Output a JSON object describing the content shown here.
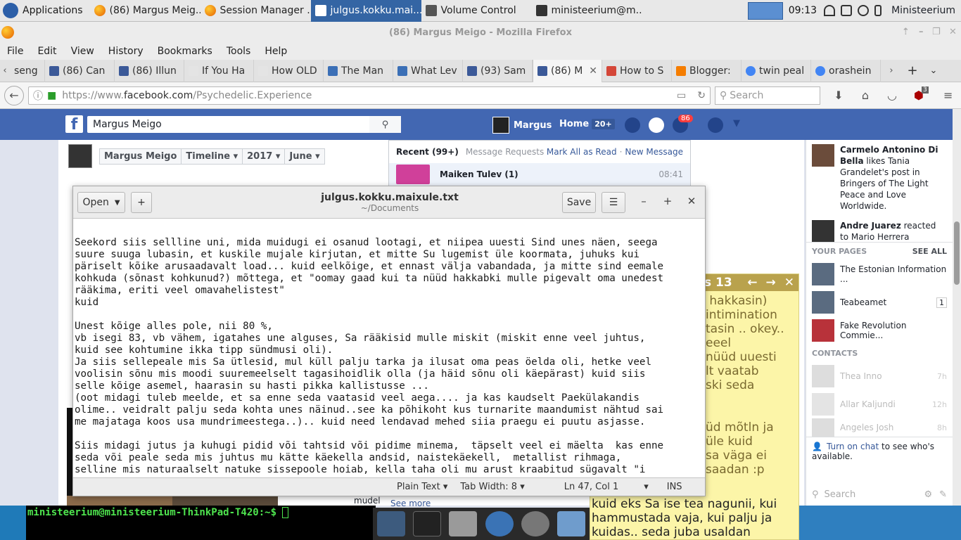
{
  "panel": {
    "apps_label": "Applications",
    "tasks": [
      {
        "label": "(86) Margus Meig...",
        "active": false
      },
      {
        "label": "Session Manager ...",
        "active": false
      },
      {
        "label": "julgus.kokku.mai...",
        "active": true
      },
      {
        "label": "Volume Control",
        "active": false
      },
      {
        "label": "ministeerium@m...",
        "active": false
      }
    ],
    "clock": "09:13",
    "user": "Ministeerium"
  },
  "firefox": {
    "title": "(86) Margus Meigo - Mozilla Firefox",
    "menu": [
      "File",
      "Edit",
      "View",
      "History",
      "Bookmarks",
      "Tools",
      "Help"
    ],
    "tabs": [
      {
        "label": "seng",
        "color": "#ffffff"
      },
      {
        "label": "(86) Can",
        "color": "#3b5998"
      },
      {
        "label": "(86) Illun",
        "color": "#3b5998"
      },
      {
        "label": "If You Ha",
        "color": "#e4e4e4"
      },
      {
        "label": "How OLD",
        "color": "#e4e4e4"
      },
      {
        "label": "The Man",
        "color": "#3b6fb6"
      },
      {
        "label": "What Lev",
        "color": "#3b6fb6"
      },
      {
        "label": "(93) Sam",
        "color": "#3b5998"
      },
      {
        "label": "(86) M",
        "color": "#3b5998",
        "active": true
      },
      {
        "label": "How to S",
        "color": "#d44638"
      },
      {
        "label": "Blogger:",
        "color": "#f57d00"
      },
      {
        "label": "twin peal",
        "color": "#4285f4"
      },
      {
        "label": "orashein",
        "color": "#4285f4"
      }
    ],
    "url_prefix": "https://www.",
    "url_host": "facebook.com",
    "url_path": "/Psychedelic.Experience",
    "search_placeholder": "Search",
    "ublock_count": "3"
  },
  "facebook": {
    "search_value": "Margus Meigo",
    "user_name": "Margus",
    "home_label": "Home",
    "home_count": "20+",
    "notif_count": "86",
    "timeline": {
      "name": "Margus Meigo",
      "tl": "Timeline",
      "year": "2017",
      "month": "June"
    },
    "messages": {
      "recent": "Recent (99+)",
      "requests": "Message Requests",
      "mark_all": "Mark All as Read",
      "new_message": "New Message",
      "first_sender": "Maiken Tulev (1)",
      "first_time": "08:41"
    },
    "ticker": [
      {
        "name": "Carmelo Antonino Di Bella",
        "text": " likes Tania Grandelet's post in Bringers of The Light Peace and Love Worldwide."
      },
      {
        "name": "Andre Juarez",
        "text": " reacted to Mario Herrera Azmitia's"
      }
    ],
    "your_pages_title": "YOUR PAGES",
    "see_all": "SEE ALL",
    "pages": [
      {
        "name": "The Estonian Information ...",
        "badge": ""
      },
      {
        "name": "Teabeamet",
        "badge": "1"
      },
      {
        "name": "Fake Revolution Commie...",
        "badge": ""
      }
    ],
    "contacts_title": "CONTACTS",
    "contacts": [
      {
        "name": "Thea Inno",
        "time": "7h"
      },
      {
        "name": "Allar Kaljundi",
        "time": "12h"
      },
      {
        "name": "Angeles Josh",
        "time": "8h"
      }
    ],
    "chat_link": "Turn on chat",
    "chat_note": " to see who's available.",
    "chat_search": "Search",
    "post_footer": "mudel",
    "see_more": "See more"
  },
  "sticky": {
    "header_num": "s 13",
    "lines": " hakkasin)\nintimination\ntasin .. okey..\neeel\nnüüd uuesti\nlt vaatab\nski seda\n\n\nüd mõtln ja\nüle kuid\nsa väga ei\nsaadan :p",
    "bottom_text": "kuid eks Sa ise tea nagunii, kui\nhammustada vaja, kui palju ja\nkuidas.. seda juba usaldan"
  },
  "gedit": {
    "open_label": "Open",
    "save_label": "Save",
    "filename": "julgus.kokku.maixule.txt",
    "path": "~/Documents",
    "text": "Seekord siis sellline uni, mida muidugi ei osanud lootagi, et niipea uuesti Sind unes näen, seega\nsuure suuga lubasin, et kuskile mujale kirjutan, et mitte Su lugemist üle koormata, juhuks kui\npäriselt kõike arusaadavalt load... kuid eelkõige, et ennast välja vabandada, ja mitte sind eemale\nkohkuda (sõnast kohkunud?) mõttega, et \"oomay gaad kui ta nüüd hakkabki mulle pigevalt oma unedest\nrääkima, eriti veel omavahelistest\"\nkuid\n\nUnest kõige alles pole, nii 80 %,\nvb isegi 83, vb vähem, igatahes une alguses, Sa rääkisid mulle miskit (miskit enne veel juhtus,\nkuid see kohtumine ikka tipp sündmusi oli).\nJa siis sellepeale mis Sa ütlesid, mul küll palju tarka ja ilusat oma peas öelda oli, hetke veel\nvoolisin sõnu mis moodi suuremeelselt tagasihoidlik olla (ja häid sõnu oli käepärast) kuid siis\nselle kõige asemel, haarasin su hasti pikka kallistusse ...\n(oot midagi tuleb meelde, et sa enne seda vaatasid veel aega.... ja kas kaudselt Paekülakandis\nolime.. veidralt palju seda kohta unes näinud..see ka põhikoht kus turnarite maandumist nähtud sai\nme majataga koos usa mundrimeestega..).. kuid need lendavad mehed siia praegu ei puutu asjasse.\n\nSiis midagi jutus ja kuhugi pidid või tahtsid või pidime minema,  täpselt veel ei mäelta  kas enne\nseda või peale seda mis juhtus mu kätte käekella andsid, naistekäekell,  metallist rihmaga,\nselline mis naturaalselt natuke sissepoole hoiab, kella taha oli mu arust kraabitud sügavalt \"i",
    "status_mode": "Plain Text",
    "status_tab": "Tab Width: 8",
    "status_pos": "Ln 47, Col 1",
    "status_ins": "INS"
  },
  "terminal": {
    "prompt": "ministeerium@ministeerium-ThinkPad-T420:~$ "
  }
}
